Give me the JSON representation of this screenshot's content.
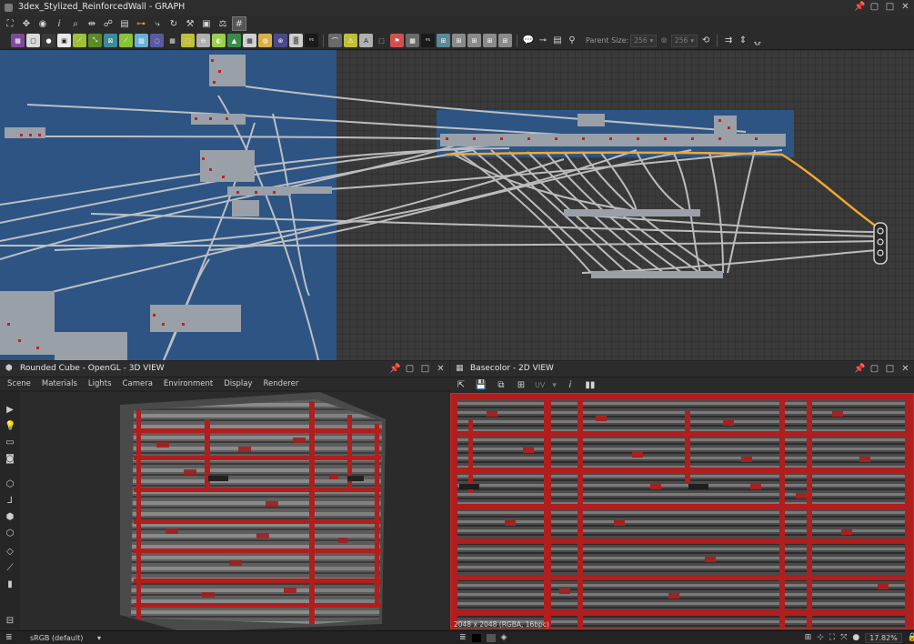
{
  "window": {
    "title": "3dex_Stylized_ReinforcedWall - GRAPH",
    "controls": {
      "pin": "📌",
      "restore": "▢",
      "maximize": "□",
      "close": "✕"
    }
  },
  "graph_toolbar": {
    "tools": [
      "frame-all",
      "pan",
      "screenshot",
      "info",
      "align",
      "layout",
      "graph-dependencies",
      "link",
      "refresh",
      "wrench",
      "camera-capture",
      "fix",
      "grid"
    ],
    "parent_size_label": "Parent Size:",
    "parent_size_w": "256",
    "parent_size_h": "256",
    "node_palette_colors": [
      "#7b4b9a",
      "#d9d9d9",
      "#3a3a3a",
      "#e8e8e8",
      "#9fbf3a",
      "#5a8a2a",
      "#3c8a9a",
      "#8ac23a",
      "#6bb0d6",
      "#5a5aa0",
      "#e0e0e0",
      "#bfbf3a",
      "#b0b0b0",
      "#9ad04a",
      "#3a8a4a",
      "#d0d0d0",
      "#d7b04a",
      "#4a4a8a",
      "#cfcfcf",
      "#1a1a1a",
      "#6a6a6a"
    ]
  },
  "view3d": {
    "title": "Rounded Cube - OpenGL - 3D VIEW",
    "menu": [
      "Scene",
      "Materials",
      "Lights",
      "Camera",
      "Environment",
      "Display",
      "Renderer"
    ],
    "color_space": "sRGB (default)"
  },
  "view2d": {
    "title": "Basecolor - 2D VIEW",
    "uv_label": "UV",
    "info": "2048 x 2048 (RGBA, 16bpc)",
    "zoom": "17.82%"
  },
  "colors": {
    "graph_frame": "#2c588c",
    "link_highlight": "#f0a830",
    "wire": "#c8c8c8",
    "wall_red": "#b22222"
  }
}
